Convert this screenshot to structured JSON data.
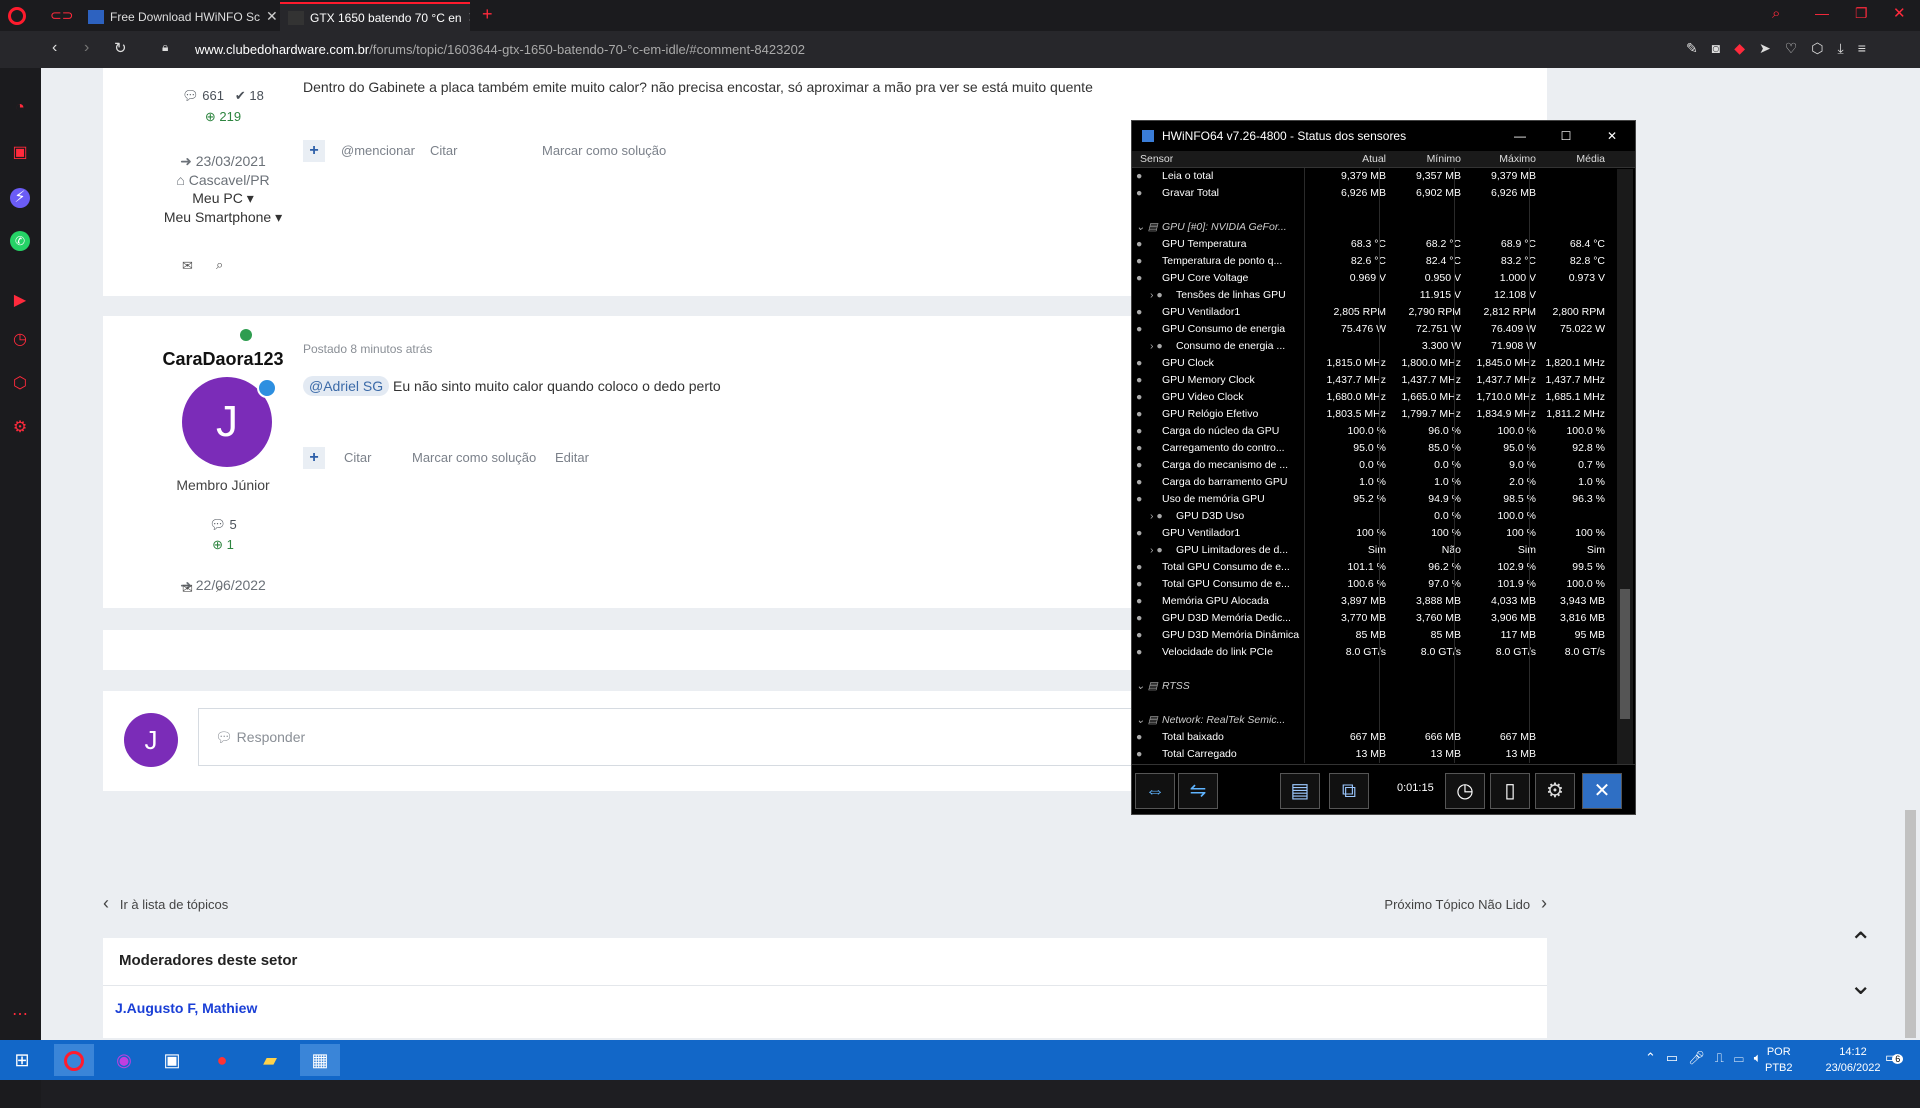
{
  "browser": {
    "tabs": [
      {
        "label": "Free Download HWiNFO Sc",
        "active": false
      },
      {
        "label": "GTX 1650 batendo 70 °C en",
        "active": true
      }
    ],
    "url_domain": "www.clubedohardware.com.br",
    "url_path": "/forums/topic/1603644-gtx-1650-batendo-70-°c-em-idle/#comment-8423202"
  },
  "post1": {
    "comments": "661",
    "checks": "18",
    "reputation": "219",
    "joined": "23/03/2021",
    "location": "Cascavel/PR",
    "pc": "Meu PC",
    "phone": "Meu Smartphone",
    "body": "Dentro do Gabinete a placa também emite muito calor? não precisa encostar, só aproximar a mão pra ver se está muito quente",
    "actions": [
      "@mencionar",
      "Citar",
      "Marcar como solução"
    ]
  },
  "post2": {
    "username": "CaraDaora123",
    "avatar_letter": "J",
    "rank": "Membro Júnior",
    "comments": "5",
    "reputation": "1",
    "joined": "22/06/2022",
    "time": "Postado 8 minutos atrás",
    "mention": "@Adriel SG",
    "body": "Eu não sinto muito calor quando coloco o dedo perto",
    "actions": [
      "Citar",
      "Marcar como solução",
      "Editar"
    ]
  },
  "reply": {
    "avatar_letter": "J",
    "placeholder": "Responder"
  },
  "nav": {
    "back": "Ir à lista de tópicos",
    "next": "Próximo Tópico Não Lido"
  },
  "moderators": {
    "title": "Moderadores deste setor",
    "names": "J.Augusto F, Mathiew"
  },
  "hwinfo": {
    "title": "HWiNFO64 v7.26-4800 - Status dos sensores",
    "headers": [
      "Sensor",
      "Atual",
      "Mínimo",
      "Máximo",
      "Média"
    ],
    "timer": "0:01:15",
    "rows": [
      {
        "n": "Leia o total",
        "a": "9,379 MB",
        "mi": "9,357 MB",
        "ma": "9,379 MB",
        "av": ""
      },
      {
        "n": "Gravar Total",
        "a": "6,926 MB",
        "mi": "6,902 MB",
        "ma": "6,926 MB",
        "av": ""
      },
      {
        "n": "",
        "a": "",
        "mi": "",
        "ma": "",
        "av": ""
      },
      {
        "n": "GPU [#0]: NVIDIA GeFor...",
        "a": "",
        "mi": "",
        "ma": "",
        "av": "",
        "group": true
      },
      {
        "n": "GPU Temperatura",
        "a": "68.3 °C",
        "mi": "68.2 °C",
        "ma": "68.9 °C",
        "av": "68.4 °C"
      },
      {
        "n": "Temperatura de ponto q...",
        "a": "82.6 °C",
        "mi": "82.4 °C",
        "ma": "83.2 °C",
        "av": "82.8 °C"
      },
      {
        "n": "GPU Core Voltage",
        "a": "0.969 V",
        "mi": "0.950 V",
        "ma": "1.000 V",
        "av": "0.973 V"
      },
      {
        "n": "Tensões de linhas GPU",
        "a": "",
        "mi": "11.915 V",
        "ma": "12.108 V",
        "av": "",
        "sub": true
      },
      {
        "n": "GPU Ventilador1",
        "a": "2,805 RPM",
        "mi": "2,790 RPM",
        "ma": "2,812 RPM",
        "av": "2,800 RPM"
      },
      {
        "n": "GPU Consumo de energia",
        "a": "75.476 W",
        "mi": "72.751 W",
        "ma": "76.409 W",
        "av": "75.022 W"
      },
      {
        "n": "Consumo de energia ...",
        "a": "",
        "mi": "3.300 W",
        "ma": "71.908 W",
        "av": "",
        "sub": true
      },
      {
        "n": "GPU Clock",
        "a": "1,815.0 MHz",
        "mi": "1,800.0 MHz",
        "ma": "1,845.0 MHz",
        "av": "1,820.1 MHz"
      },
      {
        "n": "GPU Memory Clock",
        "a": "1,437.7 MHz",
        "mi": "1,437.7 MHz",
        "ma": "1,437.7 MHz",
        "av": "1,437.7 MHz"
      },
      {
        "n": "GPU Video Clock",
        "a": "1,680.0 MHz",
        "mi": "1,665.0 MHz",
        "ma": "1,710.0 MHz",
        "av": "1,685.1 MHz"
      },
      {
        "n": "GPU Relógio Efetivo",
        "a": "1,803.5 MHz",
        "mi": "1,799.7 MHz",
        "ma": "1,834.9 MHz",
        "av": "1,811.2 MHz"
      },
      {
        "n": "Carga do núcleo da GPU",
        "a": "100.0 %",
        "mi": "96.0 %",
        "ma": "100.0 %",
        "av": "100.0 %"
      },
      {
        "n": "Carregamento do contro...",
        "a": "95.0 %",
        "mi": "85.0 %",
        "ma": "95.0 %",
        "av": "92.8 %"
      },
      {
        "n": "Carga do mecanismo de ...",
        "a": "0.0 %",
        "mi": "0.0 %",
        "ma": "9.0 %",
        "av": "0.7 %"
      },
      {
        "n": "Carga do barramento GPU",
        "a": "1.0 %",
        "mi": "1.0 %",
        "ma": "2.0 %",
        "av": "1.0 %"
      },
      {
        "n": "Uso de memória GPU",
        "a": "95.2 %",
        "mi": "94.9 %",
        "ma": "98.5 %",
        "av": "96.3 %"
      },
      {
        "n": "GPU D3D Uso",
        "a": "",
        "mi": "0.0 %",
        "ma": "100.0 %",
        "av": "",
        "sub": true
      },
      {
        "n": "GPU Ventilador1",
        "a": "100 %",
        "mi": "100 %",
        "ma": "100 %",
        "av": "100 %"
      },
      {
        "n": "GPU Limitadores de d...",
        "a": "Sim",
        "mi": "Não",
        "ma": "Sim",
        "av": "Sim",
        "sub": true
      },
      {
        "n": "Total GPU Consumo de e...",
        "a": "101.1 %",
        "mi": "96.2 %",
        "ma": "102.9 %",
        "av": "99.5 %"
      },
      {
        "n": "Total GPU Consumo de e...",
        "a": "100.6 %",
        "mi": "97.0 %",
        "ma": "101.9 %",
        "av": "100.0 %"
      },
      {
        "n": "Memória GPU Alocada",
        "a": "3,897 MB",
        "mi": "3,888 MB",
        "ma": "4,033 MB",
        "av": "3,943 MB"
      },
      {
        "n": "GPU D3D Memória Dedic...",
        "a": "3,770 MB",
        "mi": "3,760 MB",
        "ma": "3,906 MB",
        "av": "3,816 MB"
      },
      {
        "n": "GPU D3D Memória Dinâmica",
        "a": "85 MB",
        "mi": "85 MB",
        "ma": "117 MB",
        "av": "95 MB"
      },
      {
        "n": "Velocidade do link PCIe",
        "a": "8.0 GT/s",
        "mi": "8.0 GT/s",
        "ma": "8.0 GT/s",
        "av": "8.0 GT/s"
      },
      {
        "n": "",
        "a": "",
        "mi": "",
        "ma": "",
        "av": ""
      },
      {
        "n": "RTSS",
        "a": "",
        "mi": "",
        "ma": "",
        "av": "",
        "group": true
      },
      {
        "n": "",
        "a": "",
        "mi": "",
        "ma": "",
        "av": ""
      },
      {
        "n": "Network: RealTek Semic...",
        "a": "",
        "mi": "",
        "ma": "",
        "av": "",
        "group": true
      },
      {
        "n": "Total baixado",
        "a": "667 MB",
        "mi": "666 MB",
        "ma": "667 MB",
        "av": ""
      },
      {
        "n": "Total Carregado",
        "a": "13 MB",
        "mi": "13 MB",
        "ma": "13 MB",
        "av": ""
      }
    ]
  },
  "taskbar": {
    "lang": "POR",
    "layout": "PTB2",
    "time": "14:12",
    "date": "23/06/2022",
    "notifications": "6"
  },
  "colors": {
    "opera_red": "#ff1b2d",
    "link_blue": "#1a3fd6",
    "avatar_purple": "#7b2cb8",
    "taskbar_blue": "#1267c8"
  }
}
